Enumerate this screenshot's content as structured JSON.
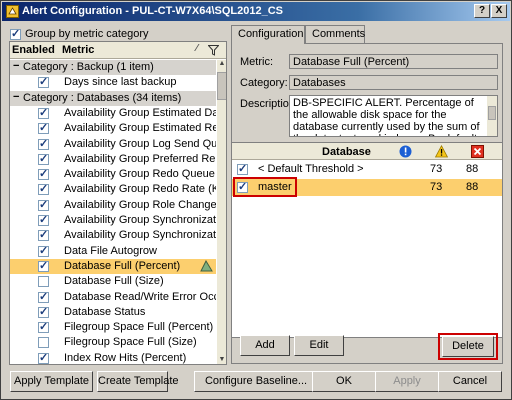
{
  "window": {
    "title": "Alert Configuration - PUL-CT-W7X64\\SQL2012_CS",
    "help_label": "?",
    "close_label": "X"
  },
  "left": {
    "group_by_label": "Group by metric category",
    "header": {
      "enabled": "Enabled",
      "metric": "Metric"
    },
    "rows": [
      {
        "type": "category",
        "label": "Category : Backup (1 item)"
      },
      {
        "type": "metric",
        "label": "Days since last backup",
        "checked": true
      },
      {
        "type": "category",
        "label": "Category : Databases (34 items)"
      },
      {
        "type": "metric",
        "label": "Availability Group Estimated Data...",
        "checked": true
      },
      {
        "type": "metric",
        "label": "Availability Group Estimated Recov...",
        "checked": true
      },
      {
        "type": "metric",
        "label": "Availability Group Log Send Queue...",
        "checked": true
      },
      {
        "type": "metric",
        "label": "Availability Group Preferred Replica",
        "checked": true
      },
      {
        "type": "metric",
        "label": "Availability Group Redo Queue Siz...",
        "checked": true
      },
      {
        "type": "metric",
        "label": "Availability Group Redo Rate (KB/s...",
        "checked": true
      },
      {
        "type": "metric",
        "label": "Availability Group Role Change",
        "checked": true
      },
      {
        "type": "metric",
        "label": "Availability Group Synchronization...",
        "checked": true
      },
      {
        "type": "metric",
        "label": "Availability Group Synchronization...",
        "checked": true
      },
      {
        "type": "metric",
        "label": "Data File Autogrow",
        "checked": true
      },
      {
        "type": "metric",
        "label": "Database Full (Percent)",
        "checked": true,
        "selected": true
      },
      {
        "type": "metric",
        "label": "Database Full (Size)",
        "checked": false
      },
      {
        "type": "metric",
        "label": "Database Read/Write Error Occurr...",
        "checked": true
      },
      {
        "type": "metric",
        "label": "Database Status",
        "checked": true
      },
      {
        "type": "metric",
        "label": "Filegroup Space Full (Percent)",
        "checked": true
      },
      {
        "type": "metric",
        "label": "Filegroup Space Full (Size)",
        "checked": false
      },
      {
        "type": "metric",
        "label": "Index Row Hits (Percent)",
        "checked": true
      }
    ]
  },
  "tabs": [
    {
      "label": "Configuration",
      "active": true
    },
    {
      "label": "Comments",
      "active": false
    }
  ],
  "config": {
    "metric_label": "Metric:",
    "metric_value": "Database Full (Percent)",
    "category_label": "Category:",
    "category_value": "Databases",
    "description_label": "Description:",
    "description_value": "DB-SPECIFIC ALERT. Percentage of the allowable disk space for the database currently used by the sum of the data, text, and indexes. By default, this percentage includes the current"
  },
  "grid": {
    "header_database": "Database",
    "rows": [
      {
        "name": "< Default Threshold >",
        "v1": "73",
        "v2": "88",
        "checked": true
      },
      {
        "name": "master",
        "v1": "73",
        "v2": "88",
        "checked": true,
        "selected": true
      }
    ]
  },
  "buttons": {
    "add": "Add",
    "edit": "Edit",
    "delete": "Delete",
    "apply_template": "Apply Template",
    "create_template": "Create Template",
    "configure_baseline": "Configure Baseline...",
    "ok": "OK",
    "apply": "Apply",
    "cancel": "Cancel"
  },
  "colors": {
    "selection": "#fccf6e",
    "highlight_border": "#cc0000",
    "title_bar": "#0a246a"
  }
}
